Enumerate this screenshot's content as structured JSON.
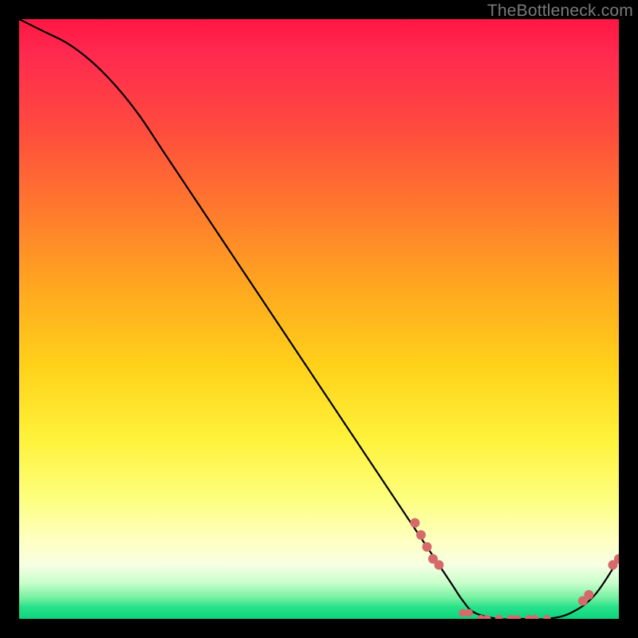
{
  "watermark": "TheBottleneck.com",
  "chart_data": {
    "type": "line",
    "title": "",
    "xlabel": "",
    "ylabel": "",
    "xlim": [
      0,
      100
    ],
    "ylim": [
      0,
      100
    ],
    "grid": false,
    "legend": false,
    "series": [
      {
        "name": "bottleneck-curve",
        "color": "#000000",
        "x": [
          0,
          4,
          8,
          12,
          16,
          20,
          24,
          28,
          32,
          36,
          40,
          44,
          48,
          52,
          56,
          60,
          64,
          68,
          72,
          74,
          76,
          80,
          84,
          88,
          92,
          96,
          100
        ],
        "y": [
          100,
          98,
          96,
          93,
          89,
          84,
          78,
          72,
          66,
          60,
          54,
          48,
          42,
          36,
          30,
          24,
          18,
          12,
          6,
          3,
          1,
          0,
          0,
          0,
          1,
          4,
          10
        ]
      }
    ],
    "markers": [
      {
        "x": 66,
        "y": 16,
        "color": "#d46a6a",
        "r": 6
      },
      {
        "x": 67,
        "y": 14,
        "color": "#d46a6a",
        "r": 6
      },
      {
        "x": 68,
        "y": 12,
        "color": "#d46a6a",
        "r": 6
      },
      {
        "x": 69,
        "y": 10,
        "color": "#d46a6a",
        "r": 6
      },
      {
        "x": 70,
        "y": 9,
        "color": "#d46a6a",
        "r": 6
      },
      {
        "x": 74,
        "y": 1,
        "color": "#d46a6a",
        "r": 5
      },
      {
        "x": 75,
        "y": 1,
        "color": "#d46a6a",
        "r": 5
      },
      {
        "x": 77,
        "y": 0,
        "color": "#d46a6a",
        "r": 5
      },
      {
        "x": 78,
        "y": 0,
        "color": "#d46a6a",
        "r": 5
      },
      {
        "x": 80,
        "y": 0,
        "color": "#d46a6a",
        "r": 5
      },
      {
        "x": 82,
        "y": 0,
        "color": "#d46a6a",
        "r": 5
      },
      {
        "x": 83,
        "y": 0,
        "color": "#d46a6a",
        "r": 5
      },
      {
        "x": 85,
        "y": 0,
        "color": "#d46a6a",
        "r": 5
      },
      {
        "x": 86,
        "y": 0,
        "color": "#d46a6a",
        "r": 5
      },
      {
        "x": 88,
        "y": 0,
        "color": "#d46a6a",
        "r": 5
      },
      {
        "x": 94,
        "y": 3,
        "color": "#d46a6a",
        "r": 6
      },
      {
        "x": 95,
        "y": 4,
        "color": "#d46a6a",
        "r": 6
      },
      {
        "x": 99,
        "y": 9,
        "color": "#d46a6a",
        "r": 6
      },
      {
        "x": 100,
        "y": 10,
        "color": "#d46a6a",
        "r": 6
      }
    ]
  }
}
